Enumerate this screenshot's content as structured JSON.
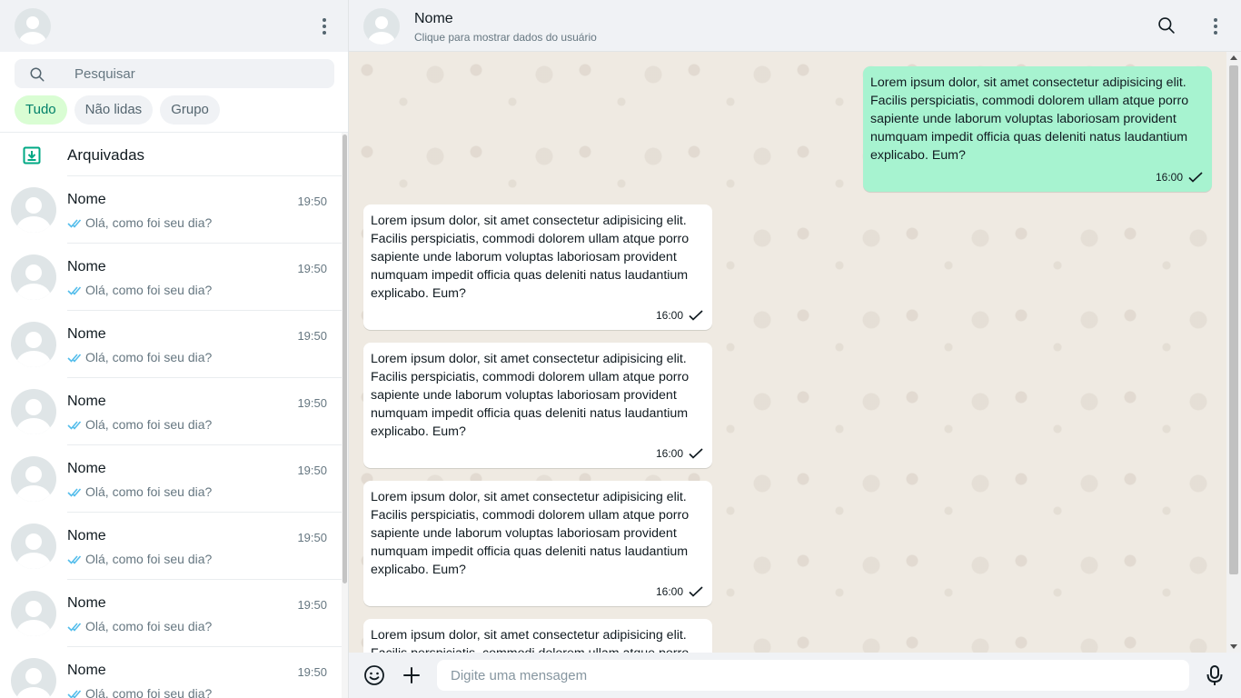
{
  "sidebar": {
    "search": {
      "placeholder": "Pesquisar"
    },
    "filters": [
      {
        "label": "Tudo",
        "active": true
      },
      {
        "label": "Não lidas",
        "active": false
      },
      {
        "label": "Grupo",
        "active": false
      }
    ],
    "archived_label": "Arquivadas",
    "chats": [
      {
        "name": "Nome",
        "time": "19:50",
        "preview": "Olá, como foi seu dia?"
      },
      {
        "name": "Nome",
        "time": "19:50",
        "preview": "Olá, como foi seu dia?"
      },
      {
        "name": "Nome",
        "time": "19:50",
        "preview": "Olá, como foi seu dia?"
      },
      {
        "name": "Nome",
        "time": "19:50",
        "preview": "Olá, como foi seu dia?"
      },
      {
        "name": "Nome",
        "time": "19:50",
        "preview": "Olá, como foi seu dia?"
      },
      {
        "name": "Nome",
        "time": "19:50",
        "preview": "Olá, como foi seu dia?"
      },
      {
        "name": "Nome",
        "time": "19:50",
        "preview": "Olá, como foi seu dia?"
      },
      {
        "name": "Nome",
        "time": "19:50",
        "preview": "Olá, como foi seu dia?"
      }
    ]
  },
  "conversation": {
    "contact_name": "Nome",
    "contact_subtitle": "Clique para mostrar dados do usuário",
    "messages": [
      {
        "direction": "outgoing",
        "text": "Lorem ipsum dolor, sit amet consectetur adipisicing elit. Facilis perspiciatis, commodi dolorem ullam atque porro sapiente unde laborum voluptas laboriosam provident numquam impedit officia quas deleniti natus laudantium explicabo. Eum?",
        "time": "16:00"
      },
      {
        "direction": "incoming",
        "text": "Lorem ipsum dolor, sit amet consectetur adipisicing elit. Facilis perspiciatis, commodi dolorem ullam atque porro sapiente unde laborum voluptas laboriosam provident numquam impedit officia quas deleniti natus laudantium explicabo. Eum?",
        "time": "16:00"
      },
      {
        "direction": "incoming",
        "text": "Lorem ipsum dolor, sit amet consectetur adipisicing elit. Facilis perspiciatis, commodi dolorem ullam atque porro sapiente unde laborum voluptas laboriosam provident numquam impedit officia quas deleniti natus laudantium explicabo. Eum?",
        "time": "16:00"
      },
      {
        "direction": "incoming",
        "text": "Lorem ipsum dolor, sit amet consectetur adipisicing elit. Facilis perspiciatis, commodi dolorem ullam atque porro sapiente unde laborum voluptas laboriosam provident numquam impedit officia quas deleniti natus laudantium explicabo. Eum?",
        "time": "16:00"
      },
      {
        "direction": "incoming",
        "text": "Lorem ipsum dolor, sit amet consectetur adipisicing elit. Facilis perspiciatis, commodi dolorem ullam atque porro sapiente unde laborum voluptas laboriosam provident numquam impedit officia quas deleniti natus laudantium explicabo. Eum?",
        "time": ""
      }
    ]
  },
  "composer": {
    "placeholder": "Digite uma mensagem"
  },
  "icons": {
    "menu": "more-vertical-icon",
    "search": "search-icon",
    "archive": "archive-icon",
    "read_receipt": "double-check-icon",
    "sent_receipt": "check-icon",
    "emoji": "emoji-icon",
    "attach": "plus-icon",
    "voice": "microphone-icon"
  },
  "colors": {
    "header_bg": "#f0f2f5",
    "chat_bg": "#efeae2",
    "outgoing_bubble": "#a7f3d0",
    "incoming_bubble": "#ffffff",
    "active_filter_bg": "#d9fdd3",
    "active_filter_text": "#008069",
    "read_receipt": "#53bdeb"
  }
}
